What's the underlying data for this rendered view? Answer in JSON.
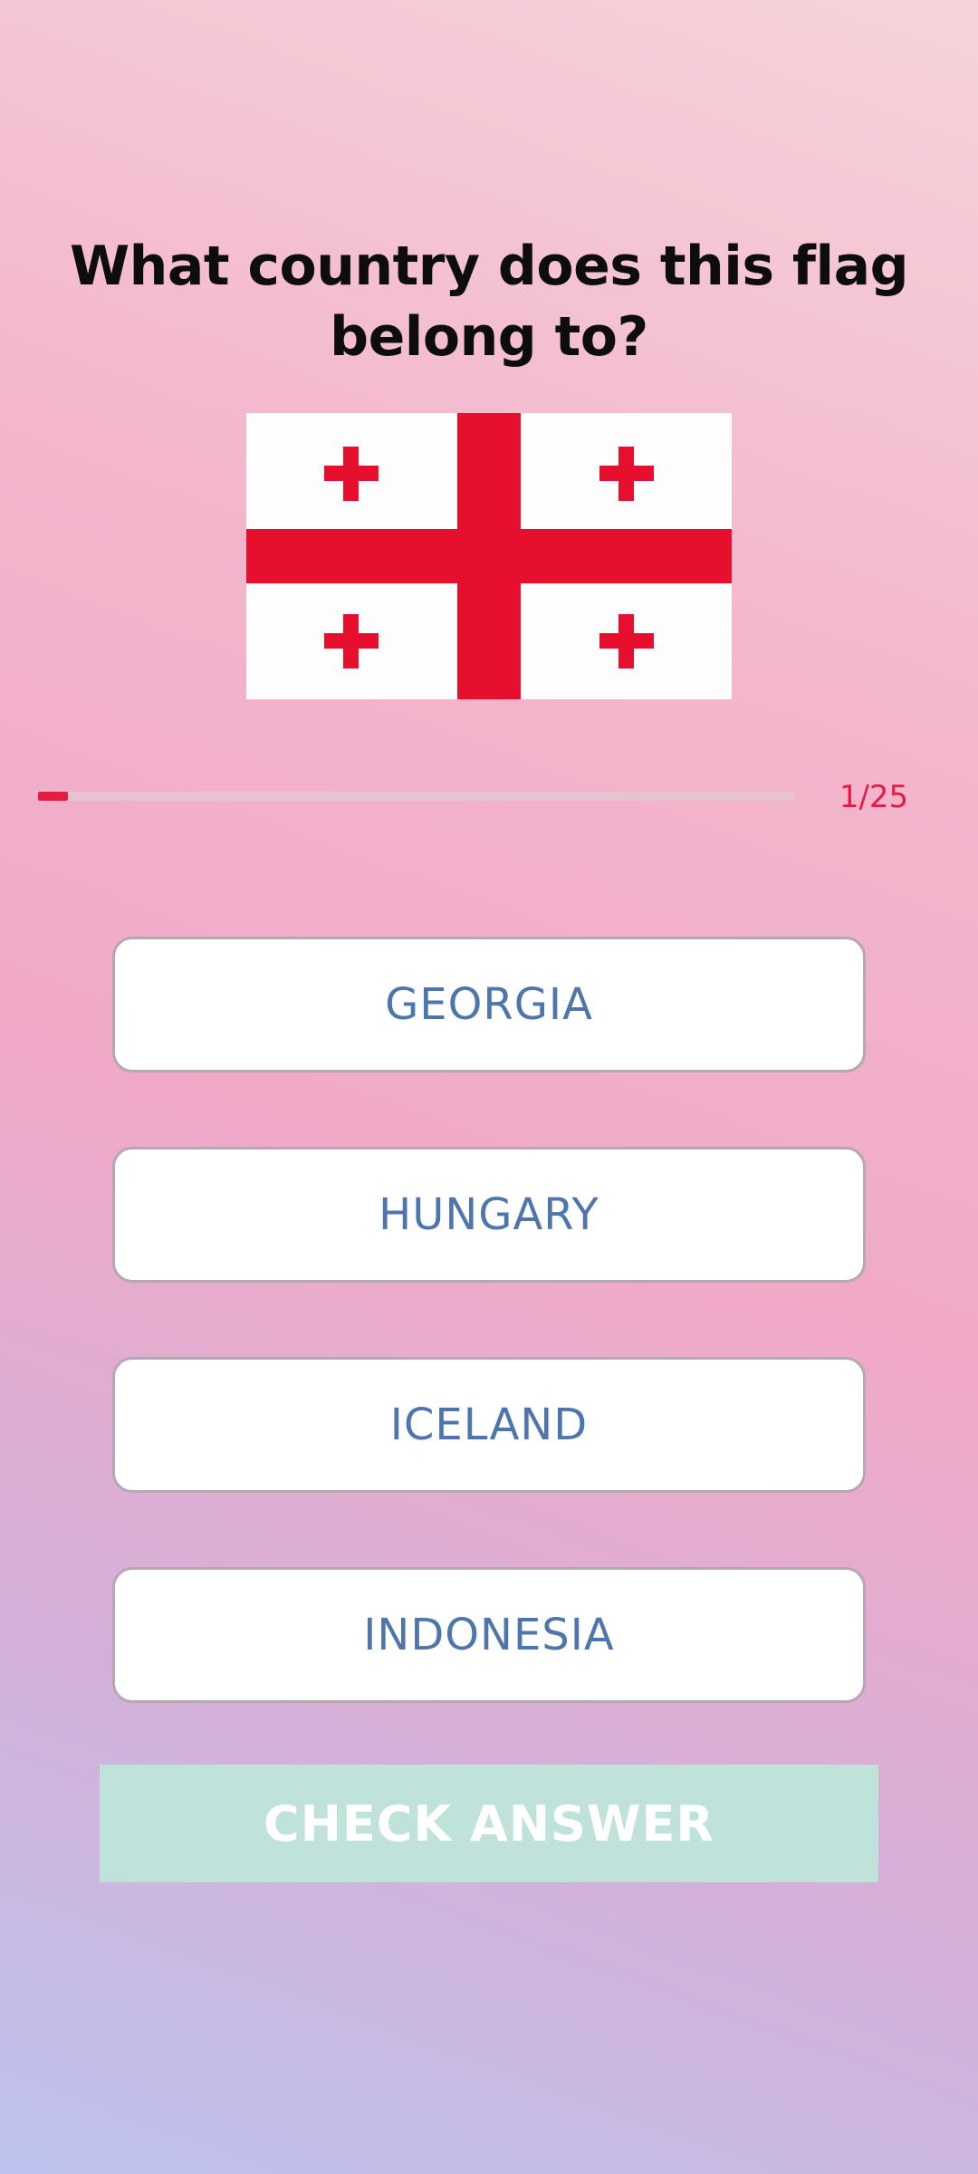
{
  "quiz": {
    "question": "What country does this flag belong to?",
    "flag": {
      "icon": "georgia-flag-icon",
      "colors": {
        "field": "#fdfdfd",
        "cross": "#e70f2e"
      }
    },
    "progress": {
      "current": 1,
      "total": 25,
      "label": "1/25",
      "fill_color": "#e31e43"
    },
    "options": [
      {
        "label": "GEORGIA"
      },
      {
        "label": "HUNGARY"
      },
      {
        "label": "ICELAND"
      },
      {
        "label": "INDONESIA"
      }
    ],
    "check_button": {
      "label": "CHECK ANSWER",
      "color": "#bfe3da"
    }
  }
}
